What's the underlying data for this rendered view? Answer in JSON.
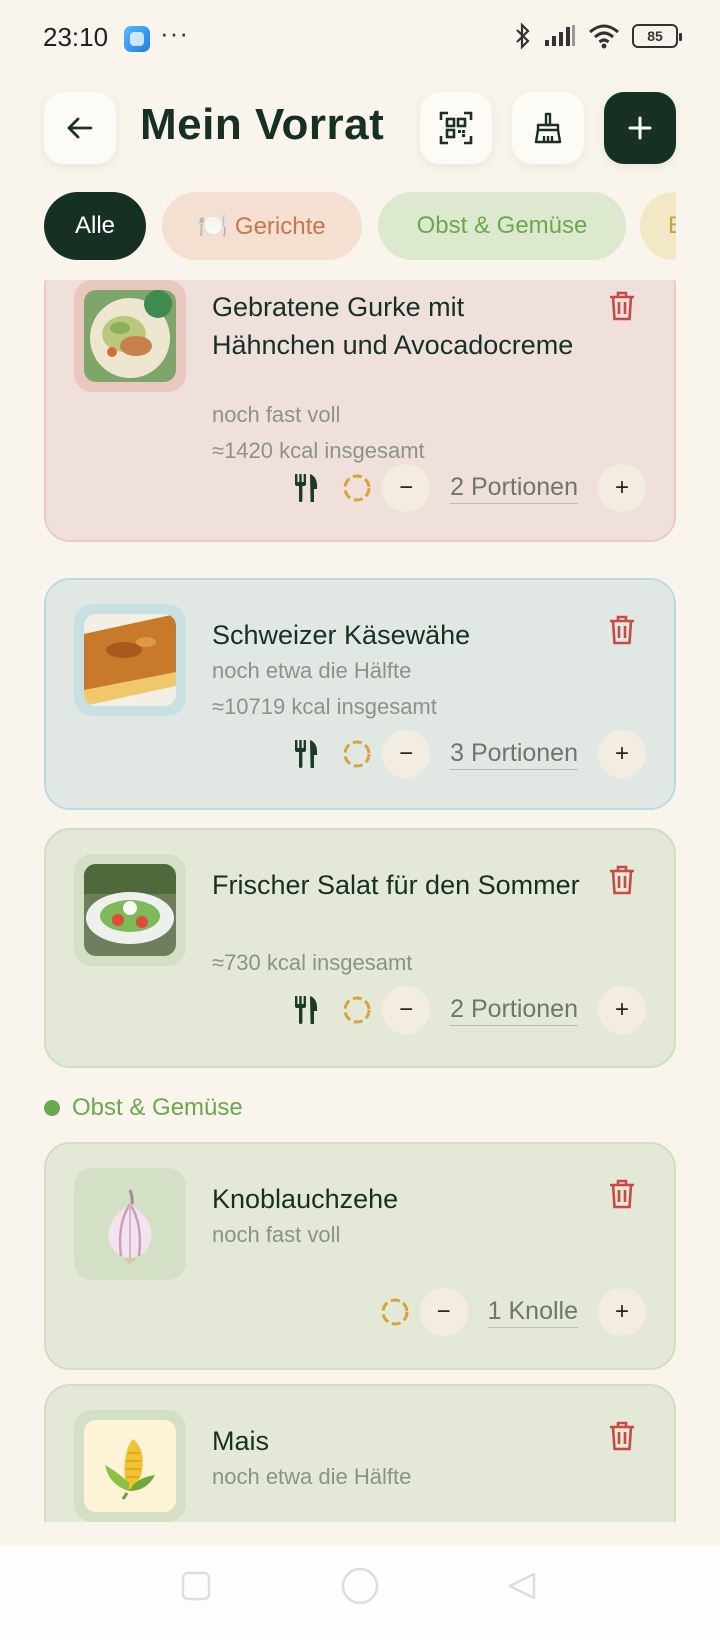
{
  "status": {
    "time": "23:10",
    "dots": "···",
    "battery": "85"
  },
  "header": {
    "title": "Mein Vorrat"
  },
  "filters": [
    {
      "label": "Alle"
    },
    {
      "label": "🍽️ Gerichte"
    },
    {
      "label": "Obst & Gemüse"
    },
    {
      "label": "B"
    }
  ],
  "items": [
    {
      "title": "Gebratene Gurke mit Hähnchen und Avocadocreme",
      "status": "noch fast voll",
      "kcal": "≈1420 kcal insgesamt",
      "quantity": "2 Portionen"
    },
    {
      "title": "Schweizer Käsewähe",
      "status": "noch etwa die Hälfte",
      "kcal": "≈10719 kcal insgesamt",
      "quantity": "3 Portionen"
    },
    {
      "title": "Frischer Salat für den Sommer",
      "kcal": "≈730 kcal insgesamt",
      "quantity": "2 Portionen"
    }
  ],
  "section_veg": {
    "label": "Obst & Gemüse"
  },
  "veg_items": [
    {
      "title": "Knoblauchzehe",
      "status": "noch fast voll",
      "quantity": "1 Knolle"
    },
    {
      "title": "Mais",
      "status": "noch etwa die Hälfte"
    }
  ],
  "buttons": {
    "minus": "−",
    "plus": "+"
  },
  "colors": {
    "primary": "#173024",
    "delete": "#c94a45",
    "accent_green": "#6aa84f",
    "ring": "#d9a23a"
  }
}
